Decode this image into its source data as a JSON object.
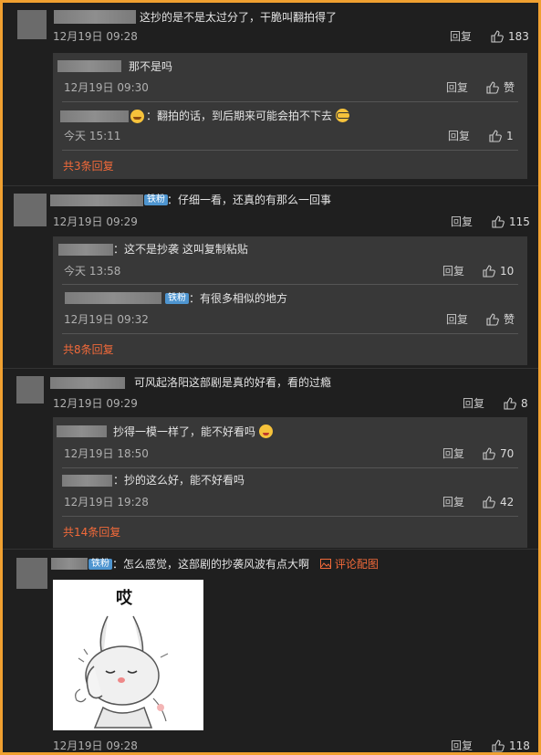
{
  "labels": {
    "reply": "回复",
    "like_empty": "赞"
  },
  "colors": {
    "accent": "#f26a3a",
    "badge": "#4e95d0",
    "frame": "#f0a030",
    "background": "#1f1f1f"
  },
  "comments": [
    {
      "text": "这抄的是不是太过分了，干脆叫翻拍得了",
      "time": "12月19日 09:28",
      "likes": "183",
      "replies": [
        {
          "text": "那不是吗",
          "time": "12月19日 09:30",
          "likes": "赞"
        },
        {
          "text": "：翻拍的话，到后期来可能会拍不下去",
          "time": "今天 15:11",
          "likes": "1",
          "emoji_after": "glasses-face"
        }
      ],
      "more": "共3条回复"
    },
    {
      "badge": "铁粉",
      "text": "：仔细一看，还真的有那么一回事",
      "time": "12月19日 09:29",
      "likes": "115",
      "replies": [
        {
          "text": "：这不是抄袭 这叫复制粘贴",
          "time": "今天 13:58",
          "likes": "10"
        },
        {
          "badge": "铁粉",
          "text": "：有很多相似的地方",
          "time": "12月19日 09:32",
          "likes": "赞"
        }
      ],
      "more": "共8条回复"
    },
    {
      "text": "可风起洛阳这部剧是真的好看，看的过瘾",
      "time": "12月19日 09:29",
      "likes": "8",
      "replies": [
        {
          "text": "抄得一模一样了，能不好看吗",
          "time": "12月19日 18:50",
          "likes": "70",
          "emoji_after": "drooling-face"
        },
        {
          "text": "：抄的这么好，能不好看吗",
          "time": "12月19日 19:28",
          "likes": "42"
        }
      ],
      "more": "共14条回复"
    },
    {
      "badge": "铁粉",
      "text": "：怎么感觉，这部剧的抄袭风波有点大啊",
      "image_link": "评论配图",
      "image_caption": "哎",
      "time": "12月19日 09:28",
      "likes": "118"
    }
  ]
}
